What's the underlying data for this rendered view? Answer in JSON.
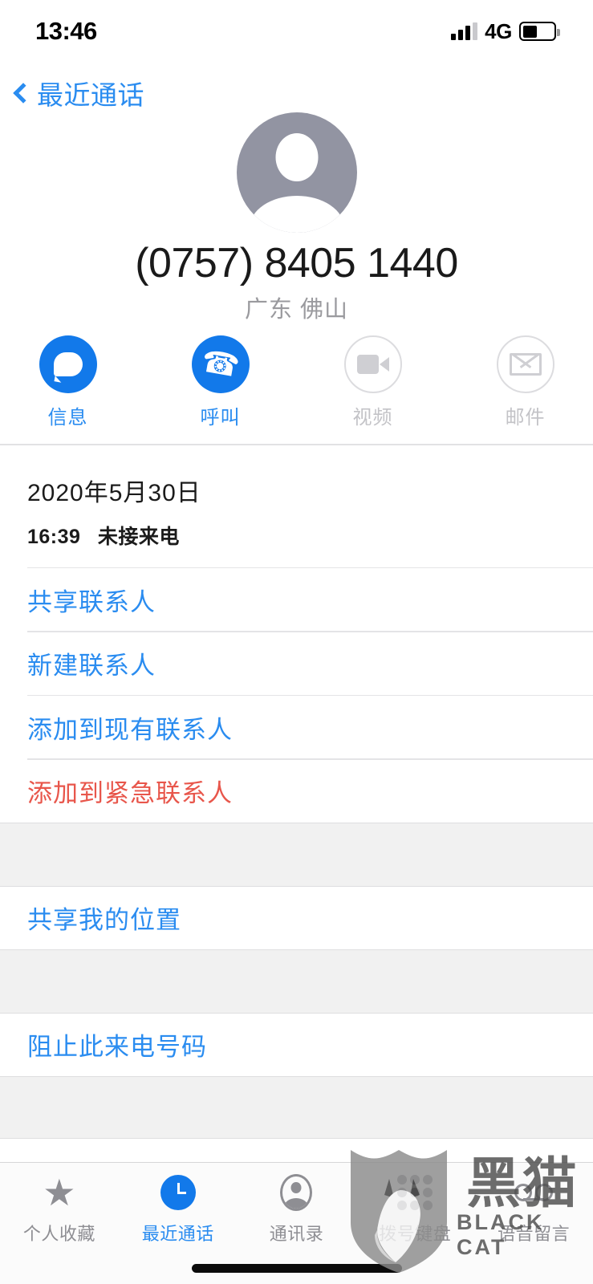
{
  "status_bar": {
    "time": "13:46",
    "network": "4G",
    "signal_icon": "signal-bars-icon",
    "battery_icon": "battery-icon",
    "signal_bars_filled": 3,
    "signal_bars_total": 4,
    "battery_percent": 48
  },
  "nav": {
    "back_label": "最近通话",
    "back_icon": "chevron-left-icon",
    "accent_color": "#2a8cf0"
  },
  "contact": {
    "avatar_icon": "person-placeholder-icon",
    "phone_number": "(0757) 8405 1440",
    "location": "广东 佛山"
  },
  "actions": [
    {
      "label": "信息",
      "icon": "message-bubble-icon",
      "enabled": true
    },
    {
      "label": "呼叫",
      "icon": "phone-handset-icon",
      "enabled": true
    },
    {
      "label": "视频",
      "icon": "video-camera-icon",
      "enabled": false
    },
    {
      "label": "邮件",
      "icon": "envelope-icon",
      "enabled": false
    }
  ],
  "call_log": {
    "date": "2020年5月30日",
    "time": "16:39",
    "type": "未接来电"
  },
  "menu_sections": [
    {
      "rows": [
        {
          "label": "共享联系人",
          "style": "blue"
        },
        {
          "label": "新建联系人",
          "style": "blue"
        },
        {
          "label": "添加到现有联系人",
          "style": "blue"
        },
        {
          "label": "添加到紧急联系人",
          "style": "red"
        }
      ]
    },
    {
      "rows": [
        {
          "label": "共享我的位置",
          "style": "blue"
        }
      ]
    },
    {
      "rows": [
        {
          "label": "阻止此来电号码",
          "style": "blue"
        }
      ]
    }
  ],
  "tabs": [
    {
      "label": "个人收藏",
      "icon": "star-icon",
      "active": false
    },
    {
      "label": "最近通话",
      "icon": "clock-icon",
      "active": true
    },
    {
      "label": "通讯录",
      "icon": "contacts-person-icon",
      "active": false
    },
    {
      "label": "拨号键盘",
      "icon": "keypad-icon",
      "active": false
    },
    {
      "label": "语音留言",
      "icon": "voicemail-icon",
      "active": false
    }
  ],
  "watermark": {
    "cn": "黑猫",
    "en": "BLACK CAT",
    "icon": "black-cat-shield-logo"
  },
  "colors": {
    "accent_blue": "#2a8cf0",
    "button_blue": "#1279ea",
    "destructive_red": "#e8564b",
    "avatar_grey": "#9294a2",
    "section_grey": "#f1f1f1"
  }
}
